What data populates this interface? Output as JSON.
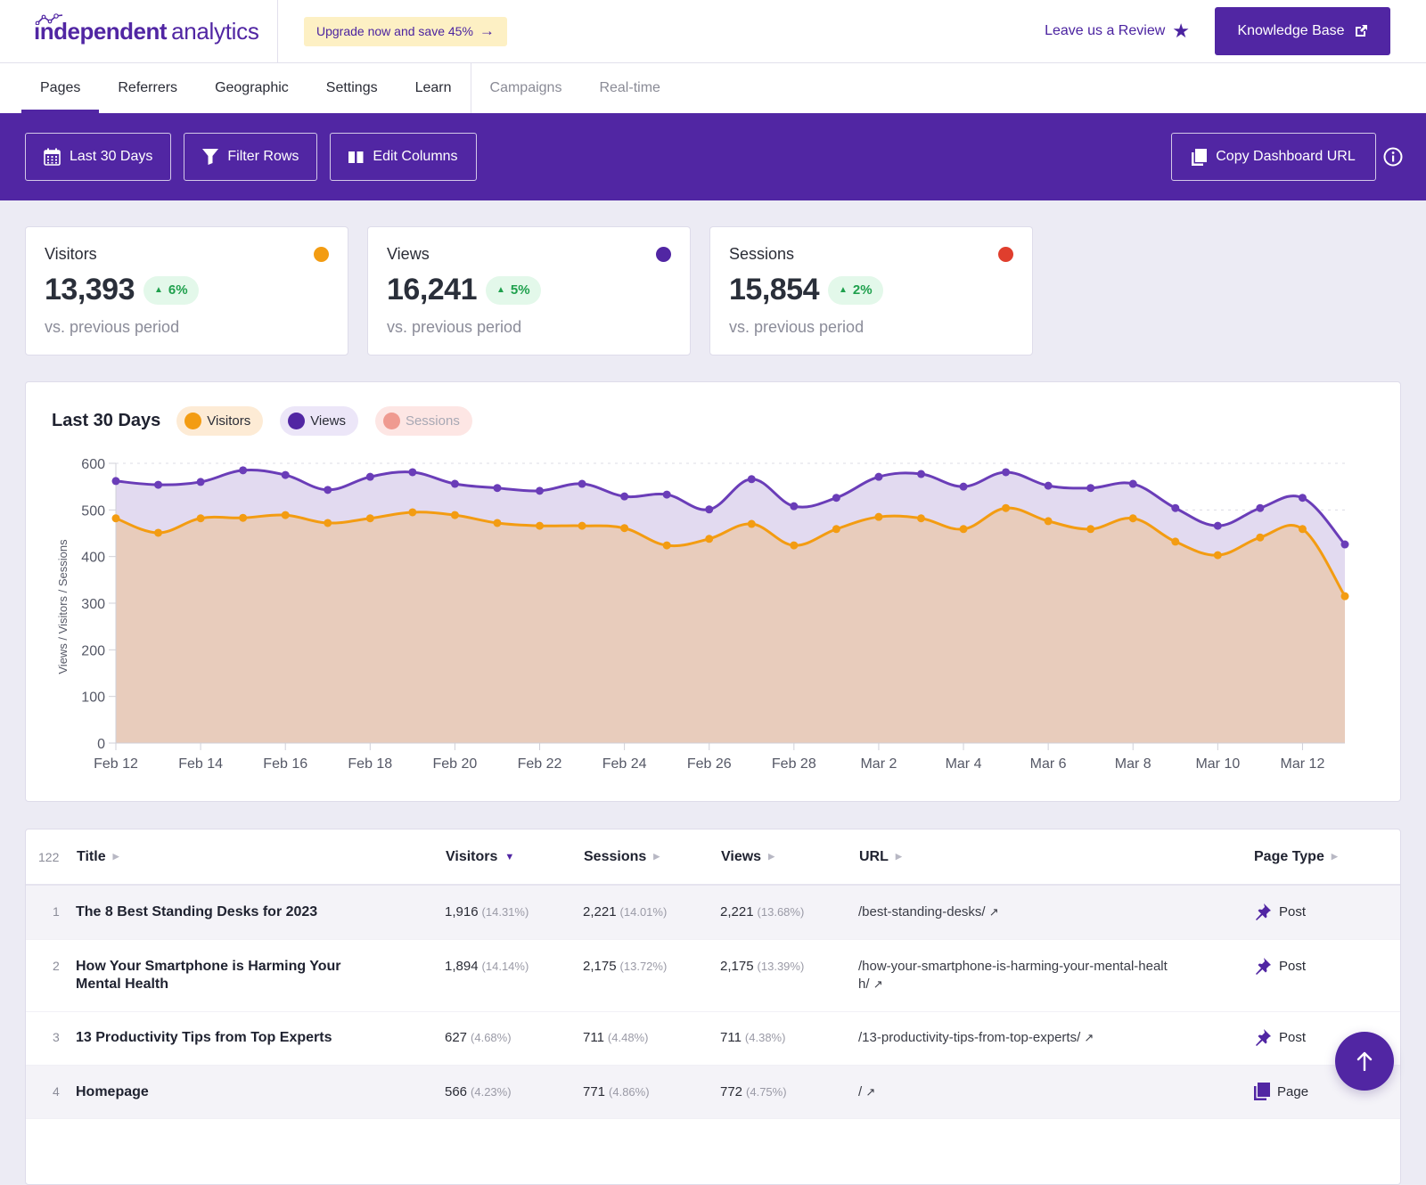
{
  "header": {
    "logo_bold": "independent",
    "logo_light": "analytics",
    "upgrade_label": "Upgrade now and save 45%",
    "review_label": "Leave us a Review",
    "knowledge_base_label": "Knowledge Base"
  },
  "nav": {
    "tabs": [
      {
        "label": "Pages",
        "active": true
      },
      {
        "label": "Referrers"
      },
      {
        "label": "Geographic"
      },
      {
        "label": "Settings"
      },
      {
        "label": "Learn"
      }
    ],
    "pro_tabs": [
      {
        "label": "Campaigns"
      },
      {
        "label": "Real-time"
      }
    ]
  },
  "toolbar": {
    "date_range_label": "Last 30 Days",
    "filter_label": "Filter Rows",
    "columns_label": "Edit Columns",
    "copy_url_label": "Copy Dashboard URL"
  },
  "kpis": [
    {
      "label": "Visitors",
      "value": "13,393",
      "change": "6%",
      "sub": "vs. previous period",
      "color": "#f39c12"
    },
    {
      "label": "Views",
      "value": "16,241",
      "change": "5%",
      "sub": "vs. previous period",
      "color": "#5126a3"
    },
    {
      "label": "Sessions",
      "value": "15,854",
      "change": "2%",
      "sub": "vs. previous period",
      "color": "#e03e2d"
    }
  ],
  "chart_data": {
    "type": "area",
    "title": "Last 30 Days",
    "xlabel": "",
    "ylabel": "Views / Visitors / Sessions",
    "ylim": [
      0,
      600
    ],
    "yticks": [
      0,
      100,
      200,
      300,
      400,
      500,
      600
    ],
    "grid": true,
    "x": [
      "Feb 12",
      "Feb 13",
      "Feb 14",
      "Feb 15",
      "Feb 16",
      "Feb 17",
      "Feb 18",
      "Feb 19",
      "Feb 20",
      "Feb 21",
      "Feb 22",
      "Feb 23",
      "Feb 24",
      "Feb 25",
      "Feb 26",
      "Feb 27",
      "Feb 28",
      "Mar 1",
      "Mar 2",
      "Mar 3",
      "Mar 4",
      "Mar 5",
      "Mar 6",
      "Mar 7",
      "Mar 8",
      "Mar 9",
      "Mar 10",
      "Mar 11",
      "Mar 12",
      "Mar 13"
    ],
    "xtick_labels": [
      "Feb 12",
      "Feb 14",
      "Feb 16",
      "Feb 18",
      "Feb 20",
      "Feb 22",
      "Feb 24",
      "Feb 26",
      "Feb 28",
      "Mar 2",
      "Mar 4",
      "Mar 6",
      "Mar 8",
      "Mar 10",
      "Mar 12"
    ],
    "legend": [
      {
        "name": "Visitors",
        "active": true,
        "color": "#f39c12",
        "bg": "#fdebd5"
      },
      {
        "name": "Views",
        "active": true,
        "color": "#5126a3",
        "bg": "#ece6f8"
      },
      {
        "name": "Sessions",
        "active": false,
        "color": "#ef9a90",
        "bg": "#fde6e4"
      }
    ],
    "series": [
      {
        "name": "Views",
        "color": "#6a3db8",
        "fill": "#e2daf0",
        "values": [
          562,
          554,
          560,
          585,
          575,
          543,
          571,
          581,
          556,
          547,
          541,
          556,
          529,
          533,
          501,
          566,
          508,
          526,
          571,
          577,
          550,
          581,
          552,
          547,
          556,
          504,
          466,
          504,
          526,
          426
        ]
      },
      {
        "name": "Visitors",
        "color": "#f39c12",
        "fill": "#e8ccbc",
        "values": [
          482,
          451,
          482,
          483,
          489,
          472,
          482,
          495,
          489,
          472,
          466,
          466,
          461,
          424,
          438,
          470,
          424,
          459,
          485,
          482,
          459,
          504,
          476,
          459,
          482,
          432,
          403,
          441,
          459,
          315
        ]
      }
    ]
  },
  "table": {
    "count": "122",
    "columns": [
      {
        "label": "Title",
        "sort": "none"
      },
      {
        "label": "Visitors",
        "sort": "desc"
      },
      {
        "label": "Sessions",
        "sort": "none"
      },
      {
        "label": "Views",
        "sort": "none"
      },
      {
        "label": "URL",
        "sort": "none"
      },
      {
        "label": "Page Type",
        "sort": "none"
      }
    ],
    "rows": [
      {
        "num": "1",
        "title": "The 8 Best Standing Desks for 2023",
        "visitors": "1,916",
        "visitors_pct": "(14.31%)",
        "sessions": "2,221",
        "sessions_pct": "(14.01%)",
        "views": "2,221",
        "views_pct": "(13.68%)",
        "url": "/best-standing-desks/",
        "type": "Post",
        "type_icon": "pin-icon"
      },
      {
        "num": "2",
        "title": "How Your Smartphone is Harming Your Mental Health",
        "visitors": "1,894",
        "visitors_pct": "(14.14%)",
        "sessions": "2,175",
        "sessions_pct": "(13.72%)",
        "views": "2,175",
        "views_pct": "(13.39%)",
        "url": "/how-your-smartphone-is-harming-your-mental-health/",
        "type": "Post",
        "type_icon": "pin-icon"
      },
      {
        "num": "3",
        "title": "13 Productivity Tips from Top Experts",
        "visitors": "627",
        "visitors_pct": "(4.68%)",
        "sessions": "711",
        "sessions_pct": "(4.48%)",
        "views": "711",
        "views_pct": "(4.38%)",
        "url": "/13-productivity-tips-from-top-experts/",
        "type": "Post",
        "type_icon": "pin-icon"
      },
      {
        "num": "4",
        "title": "Homepage",
        "visitors": "566",
        "visitors_pct": "(4.23%)",
        "sessions": "771",
        "sessions_pct": "(4.86%)",
        "views": "772",
        "views_pct": "(4.75%)",
        "url": "/",
        "type": "Page",
        "type_icon": "page-icon"
      }
    ]
  }
}
